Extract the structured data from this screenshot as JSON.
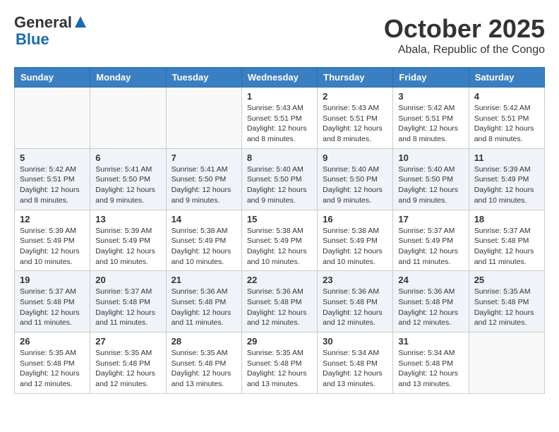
{
  "logo": {
    "general": "General",
    "blue": "Blue"
  },
  "header": {
    "month": "October 2025",
    "location": "Abala, Republic of the Congo"
  },
  "days_of_week": [
    "Sunday",
    "Monday",
    "Tuesday",
    "Wednesday",
    "Thursday",
    "Friday",
    "Saturday"
  ],
  "weeks": [
    [
      {
        "day": "",
        "info": ""
      },
      {
        "day": "",
        "info": ""
      },
      {
        "day": "",
        "info": ""
      },
      {
        "day": "1",
        "info": "Sunrise: 5:43 AM\nSunset: 5:51 PM\nDaylight: 12 hours\nand 8 minutes."
      },
      {
        "day": "2",
        "info": "Sunrise: 5:43 AM\nSunset: 5:51 PM\nDaylight: 12 hours\nand 8 minutes."
      },
      {
        "day": "3",
        "info": "Sunrise: 5:42 AM\nSunset: 5:51 PM\nDaylight: 12 hours\nand 8 minutes."
      },
      {
        "day": "4",
        "info": "Sunrise: 5:42 AM\nSunset: 5:51 PM\nDaylight: 12 hours\nand 8 minutes."
      }
    ],
    [
      {
        "day": "5",
        "info": "Sunrise: 5:42 AM\nSunset: 5:51 PM\nDaylight: 12 hours\nand 8 minutes."
      },
      {
        "day": "6",
        "info": "Sunrise: 5:41 AM\nSunset: 5:50 PM\nDaylight: 12 hours\nand 9 minutes."
      },
      {
        "day": "7",
        "info": "Sunrise: 5:41 AM\nSunset: 5:50 PM\nDaylight: 12 hours\nand 9 minutes."
      },
      {
        "day": "8",
        "info": "Sunrise: 5:40 AM\nSunset: 5:50 PM\nDaylight: 12 hours\nand 9 minutes."
      },
      {
        "day": "9",
        "info": "Sunrise: 5:40 AM\nSunset: 5:50 PM\nDaylight: 12 hours\nand 9 minutes."
      },
      {
        "day": "10",
        "info": "Sunrise: 5:40 AM\nSunset: 5:50 PM\nDaylight: 12 hours\nand 9 minutes."
      },
      {
        "day": "11",
        "info": "Sunrise: 5:39 AM\nSunset: 5:49 PM\nDaylight: 12 hours\nand 10 minutes."
      }
    ],
    [
      {
        "day": "12",
        "info": "Sunrise: 5:39 AM\nSunset: 5:49 PM\nDaylight: 12 hours\nand 10 minutes."
      },
      {
        "day": "13",
        "info": "Sunrise: 5:39 AM\nSunset: 5:49 PM\nDaylight: 12 hours\nand 10 minutes."
      },
      {
        "day": "14",
        "info": "Sunrise: 5:38 AM\nSunset: 5:49 PM\nDaylight: 12 hours\nand 10 minutes."
      },
      {
        "day": "15",
        "info": "Sunrise: 5:38 AM\nSunset: 5:49 PM\nDaylight: 12 hours\nand 10 minutes."
      },
      {
        "day": "16",
        "info": "Sunrise: 5:38 AM\nSunset: 5:49 PM\nDaylight: 12 hours\nand 10 minutes."
      },
      {
        "day": "17",
        "info": "Sunrise: 5:37 AM\nSunset: 5:49 PM\nDaylight: 12 hours\nand 11 minutes."
      },
      {
        "day": "18",
        "info": "Sunrise: 5:37 AM\nSunset: 5:48 PM\nDaylight: 12 hours\nand 11 minutes."
      }
    ],
    [
      {
        "day": "19",
        "info": "Sunrise: 5:37 AM\nSunset: 5:48 PM\nDaylight: 12 hours\nand 11 minutes."
      },
      {
        "day": "20",
        "info": "Sunrise: 5:37 AM\nSunset: 5:48 PM\nDaylight: 12 hours\nand 11 minutes."
      },
      {
        "day": "21",
        "info": "Sunrise: 5:36 AM\nSunset: 5:48 PM\nDaylight: 12 hours\nand 11 minutes."
      },
      {
        "day": "22",
        "info": "Sunrise: 5:36 AM\nSunset: 5:48 PM\nDaylight: 12 hours\nand 12 minutes."
      },
      {
        "day": "23",
        "info": "Sunrise: 5:36 AM\nSunset: 5:48 PM\nDaylight: 12 hours\nand 12 minutes."
      },
      {
        "day": "24",
        "info": "Sunrise: 5:36 AM\nSunset: 5:48 PM\nDaylight: 12 hours\nand 12 minutes."
      },
      {
        "day": "25",
        "info": "Sunrise: 5:35 AM\nSunset: 5:48 PM\nDaylight: 12 hours\nand 12 minutes."
      }
    ],
    [
      {
        "day": "26",
        "info": "Sunrise: 5:35 AM\nSunset: 5:48 PM\nDaylight: 12 hours\nand 12 minutes."
      },
      {
        "day": "27",
        "info": "Sunrise: 5:35 AM\nSunset: 5:48 PM\nDaylight: 12 hours\nand 12 minutes."
      },
      {
        "day": "28",
        "info": "Sunrise: 5:35 AM\nSunset: 5:48 PM\nDaylight: 12 hours\nand 13 minutes."
      },
      {
        "day": "29",
        "info": "Sunrise: 5:35 AM\nSunset: 5:48 PM\nDaylight: 12 hours\nand 13 minutes."
      },
      {
        "day": "30",
        "info": "Sunrise: 5:34 AM\nSunset: 5:48 PM\nDaylight: 12 hours\nand 13 minutes."
      },
      {
        "day": "31",
        "info": "Sunrise: 5:34 AM\nSunset: 5:48 PM\nDaylight: 12 hours\nand 13 minutes."
      },
      {
        "day": "",
        "info": ""
      }
    ]
  ]
}
